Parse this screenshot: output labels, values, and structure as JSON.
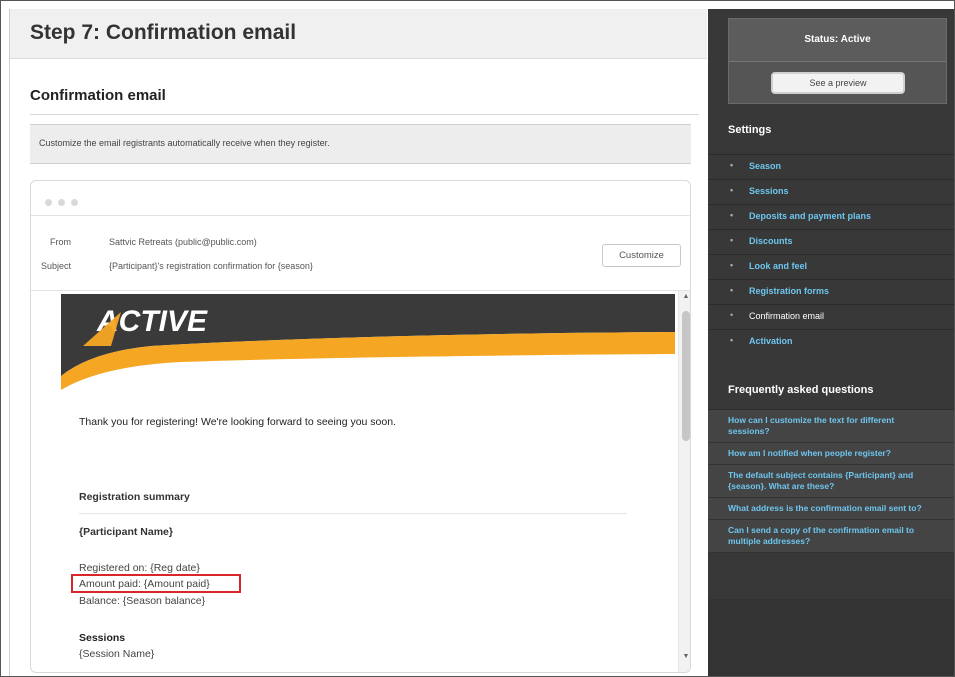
{
  "step_title": "Step 7: Confirmation email",
  "section_title": "Confirmation email",
  "description": "Customize the email registrants automatically receive when they register.",
  "email_header": {
    "from_label": "From",
    "from_value": "Sattvic Retreats  (public@public.com)",
    "subject_label": "Subject",
    "subject_value": "{Participant}'s registration confirmation for {season}",
    "customize_label": "Customize"
  },
  "email_preview": {
    "logo_text": "ACTIVE",
    "thanks_text": "Thank you for registering! We're looking forward to seeing you soon.",
    "registration_summary": "Registration summary",
    "participant_name": "{Participant Name}",
    "registered_on": "Registered on: {Reg date}",
    "amount_paid": "Amount paid: {Amount paid}",
    "balance": "Balance: {Season balance}",
    "sessions_title": "Sessions",
    "session_name": "{Session Name}"
  },
  "sidebar": {
    "status": "Status: Active",
    "preview_button": "See a preview",
    "settings_title": "Settings",
    "settings_items": [
      {
        "label": "Season"
      },
      {
        "label": "Sessions"
      },
      {
        "label": "Deposits and payment plans"
      },
      {
        "label": "Discounts"
      },
      {
        "label": "Look and feel"
      },
      {
        "label": "Registration forms"
      },
      {
        "label": "Confirmation email"
      },
      {
        "label": "Activation"
      }
    ],
    "active_item": "Confirmation email",
    "faq_title": "Frequently asked questions",
    "faq_items": [
      "How can I customize the text for different sessions?",
      "How am I notified when people register?",
      "The default subject contains {Participant} and {season}. What are these?",
      "What address is the confirmation email sent to?",
      "Can I send a copy of the confirmation email to multiple addresses?"
    ]
  },
  "colors": {
    "brand_orange": "#f5a623",
    "banner_dark": "#3a3a3a",
    "link_blue": "#6ec6ef",
    "highlight_red": "#d9262b"
  }
}
